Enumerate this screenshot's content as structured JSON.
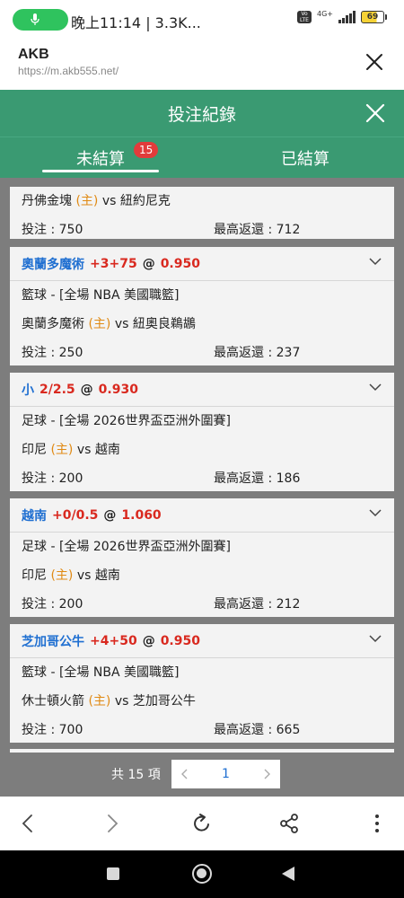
{
  "status_bar": {
    "text": "晚上11:14 | 3.3K...",
    "network": "4G+",
    "battery": "69",
    "volte": "Vo LTE"
  },
  "browser": {
    "site_title": "AKB",
    "site_url": "https://m.akb555.net/"
  },
  "modal": {
    "title": "投注紀錄",
    "tabs": {
      "unsettled_label": "未結算",
      "unsettled_badge": "15",
      "settled_label": "已結算"
    }
  },
  "labels": {
    "stake": "投注 : ",
    "max_return": "最高返還 : ",
    "vs": " vs ",
    "home_tag": "(主)",
    "at": "@"
  },
  "bets": [
    {
      "partial": true,
      "home_team": "丹佛金塊",
      "away_team": "紐約尼克",
      "stake": "750",
      "max_return": "712"
    },
    {
      "pick": "奧蘭多魔術",
      "line": "+3+75",
      "price": "0.950",
      "league": "籃球 - [全場 NBA 美國職籃]",
      "home_team": "奧蘭多魔術",
      "away_team": "紐奧良鵜鶘",
      "stake": "250",
      "max_return": "237"
    },
    {
      "pick": "小",
      "line": "2/2.5",
      "price": "0.930",
      "league": "足球 - [全場 2026世界盃亞洲外圍賽]",
      "home_team": "印尼",
      "away_team": "越南",
      "stake": "200",
      "max_return": "186"
    },
    {
      "pick": "越南",
      "line": "+0/0.5",
      "price": "1.060",
      "league": "足球 - [全場 2026世界盃亞洲外圍賽]",
      "home_team": "印尼",
      "away_team": "越南",
      "stake": "200",
      "max_return": "212"
    },
    {
      "pick": "芝加哥公牛",
      "line": "+4+50",
      "price": "0.950",
      "league": "籃球 - [全場 NBA 美國職籃]",
      "home_team": "休士頓火箭",
      "away_team": "芝加哥公牛",
      "stake": "700",
      "max_return": "665"
    }
  ],
  "pagination": {
    "total": "共 15 項",
    "current_page": "1"
  },
  "colors": {
    "header_green": "#3a9a72",
    "pick_blue": "#1f6fd1",
    "odds_red": "#d9291f",
    "home_orange": "#e08a14"
  }
}
